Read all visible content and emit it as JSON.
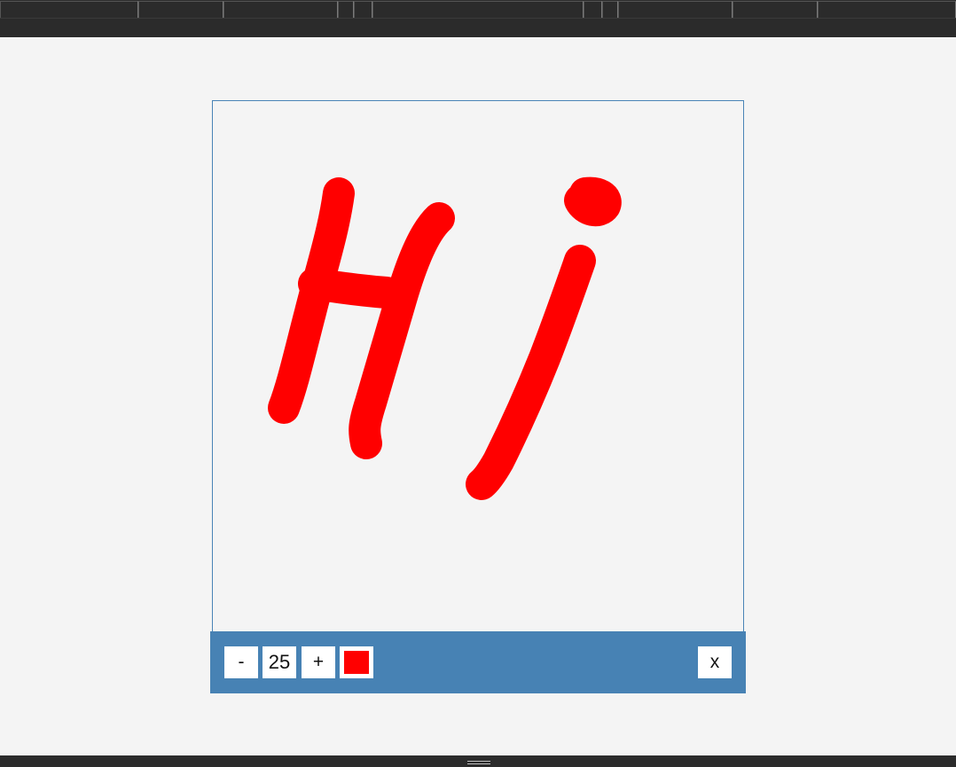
{
  "app": {
    "top_tabs_count": 11,
    "theme_dark": "#2b2b2b",
    "page_bg": "#f4f4f4"
  },
  "canvas": {
    "border_color": "#4a84b6",
    "stroke_color": "#ff0000"
  },
  "toolbar": {
    "bg_color": "#4782b4",
    "decrease_label": "-",
    "size_value": "25",
    "increase_label": "+",
    "color_swatch": "#ff0000",
    "close_label": "x"
  }
}
